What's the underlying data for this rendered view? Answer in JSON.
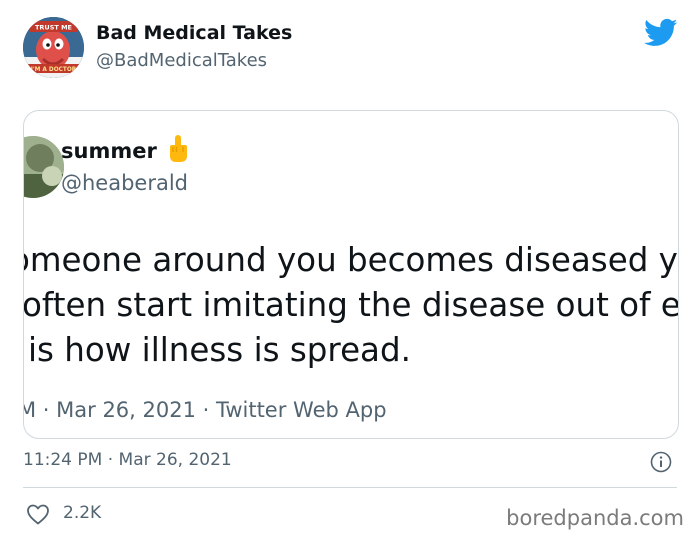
{
  "author": {
    "display_name": "Bad Medical Takes",
    "handle": "@BadMedicalTakes",
    "avatar_badge_top": "TRUST ME",
    "avatar_badge_bottom": "I'M A DOCTOR"
  },
  "quoted_tweet": {
    "display_name": "summer",
    "handle": "@heaberald",
    "lines": [
      "omeone around you becomes diseased y",
      "often start imitating the disease out of e",
      "is how illness is spread."
    ],
    "meta": "M · Mar 26, 2021 · Twitter Web App"
  },
  "tweet": {
    "timestamp": "11:24 PM · Mar 26, 2021",
    "likes": "2.2K"
  },
  "watermark": "boredpanda.com",
  "colors": {
    "brand": "#1d9bf0",
    "text": "#0f1419",
    "muted": "#536471",
    "border": "#cfd9de"
  },
  "icons": {
    "brand": "twitter-bird-icon",
    "emoji": "middle-finger-emoji-icon",
    "info": "info-icon",
    "like": "heart-icon"
  }
}
